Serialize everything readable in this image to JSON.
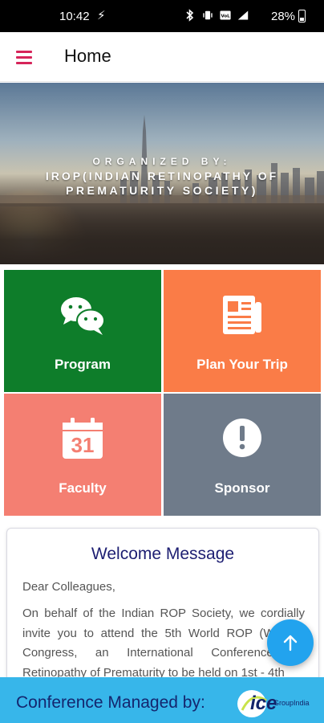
{
  "status_bar": {
    "time": "10:42",
    "battery": "28%",
    "icons": [
      "bolt-icon",
      "bluetooth-icon",
      "vibrate-icon",
      "volte-icon",
      "signal-icon",
      "battery-icon"
    ]
  },
  "app_bar": {
    "title": "Home",
    "menu_icon": "menu-icon",
    "accent_color": "#d6245a"
  },
  "hero": {
    "line1": "ORGANIZED BY:",
    "line2": "IROP(INDIAN RETINOPATHY OF",
    "line3": "PREMATURITY SOCIETY)"
  },
  "tiles": [
    {
      "label": "Program",
      "icon": "chat-bubbles-icon",
      "color": "#0e7d2a"
    },
    {
      "label": "Plan Your Trip",
      "icon": "newspaper-icon",
      "color": "#fa7c47"
    },
    {
      "label": "Faculty",
      "icon": "calendar-icon",
      "calendar_day": "31",
      "color": "#f47f72"
    },
    {
      "label": "Sponsor",
      "icon": "exclamation-icon",
      "color": "#6f7b8a"
    }
  ],
  "welcome": {
    "title": "Welcome Message",
    "greeting": "Dear Colleagues,",
    "body": "On behalf of the Indian ROP Society, we cordially invite you to attend the 5th World ROP (WROP) Congress, an International Conference on Retinopathy of Prematurity to be held on 1st - 4th"
  },
  "fab": {
    "icon": "arrow-up-icon",
    "color": "#22a3ee"
  },
  "footer": {
    "text": "Conference Managed by:",
    "logo_text": "ice",
    "logo_sub": "GroupIndia",
    "color": "#37b6ea"
  }
}
